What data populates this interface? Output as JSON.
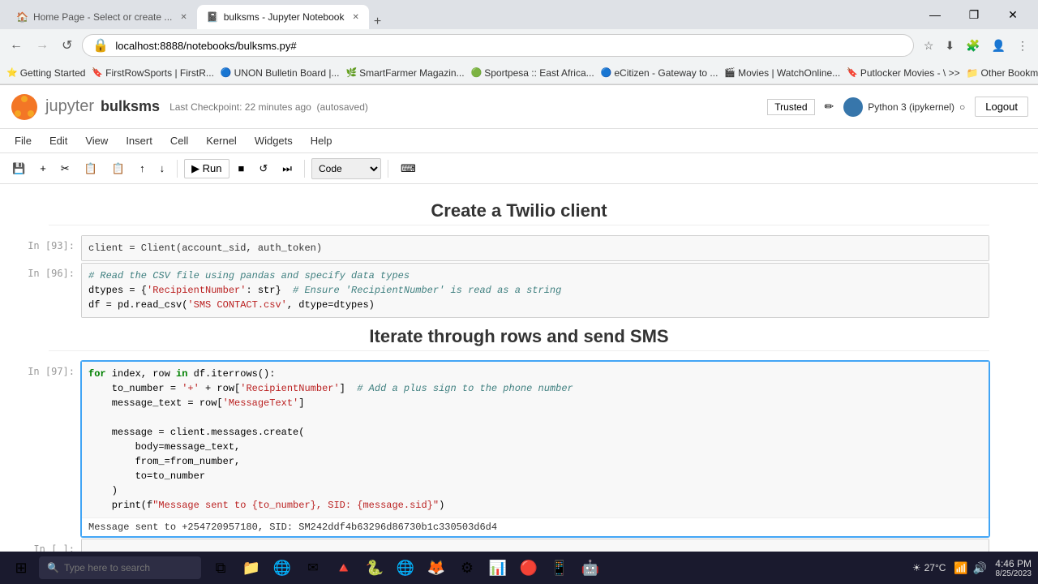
{
  "browser": {
    "tabs": [
      {
        "label": "Home Page - Select or create ...",
        "active": false,
        "favicon": "🏠"
      },
      {
        "label": "bulksms - Jupyter Notebook",
        "active": true,
        "favicon": "📓"
      }
    ],
    "address": "localhost:8888/notebooks/bulksms.py#",
    "window_controls": [
      "—",
      "❐",
      "✕"
    ]
  },
  "bookmarks": [
    {
      "label": "Getting Started",
      "icon": "⭐"
    },
    {
      "label": "FirstRowSports | FirstR...",
      "icon": "🔖"
    },
    {
      "label": "UNON Bulletin Board |...",
      "icon": "🔵"
    },
    {
      "label": "SmartFarmer Magazin...",
      "icon": "🌿"
    },
    {
      "label": "Sportpesa :: East Africa...",
      "icon": "🟢"
    },
    {
      "label": "eCitizen - Gateway to ...",
      "icon": "🔵"
    },
    {
      "label": "Movies | WatchOnline...",
      "icon": "🎬"
    },
    {
      "label": "Putlocker Movies - \\ >>",
      "icon": "🔖"
    },
    {
      "label": "Other Bookmarks",
      "icon": "📁"
    }
  ],
  "jupyter": {
    "logo_text": "jupyter",
    "notebook_name": "bulksms",
    "checkpoint": "Last Checkpoint: 22 minutes ago",
    "autosaved": "(autosaved)",
    "trusted": "Trusted",
    "kernel": "Python 3 (ipykernel)",
    "logout_label": "Logout",
    "menu": [
      "File",
      "Edit",
      "View",
      "Insert",
      "Cell",
      "Kernel",
      "Widgets",
      "Help"
    ],
    "cell_type": "Code"
  },
  "toolbar": {
    "buttons": [
      "💾",
      "+",
      "✂",
      "📋",
      "📋",
      "↑",
      "↓",
      "▶ Run",
      "■",
      "↺",
      "⏭"
    ]
  },
  "sections": {
    "twilio_heading": "Create a Twilio client",
    "iterate_heading": "Iterate through rows and send SMS"
  },
  "cells": {
    "cell93": {
      "label": "In [93]:",
      "code": "client = Client(account_sid, auth_token)"
    },
    "cell96": {
      "label": "In [96]:",
      "line1_comment": "# Read the CSV file using pandas and specify data types",
      "line2": "dtypes = {'RecipientNumber': str}  # Ensure 'RecipientNumber' is read as a string",
      "line3": "df = pd.read_csv('SMS CONTACT.csv', dtype=dtypes)"
    },
    "cell97": {
      "label": "In [97]:",
      "code_lines": [
        "for index, row in df.iterrows():",
        "    to_number = '+' + row['RecipientNumber']  # Add a plus sign to the phone number",
        "    message_text = row['MessageText']",
        "",
        "    message = client.messages.create(",
        "        body=message_text,",
        "        from_=from_number,",
        "        to=to_number",
        "    )",
        "    print(f\"Message sent to {to_number}, SID: {message.sid}\")"
      ],
      "output": "Message sent to +254720957180, SID: SM242ddf4b63296d86730b1c330503d6d4"
    },
    "empty_cell": {
      "label": "In [ ]:"
    }
  },
  "taskbar": {
    "search_placeholder": "Type here to search",
    "weather": "27°C",
    "time": "4:46 PM",
    "date": "8/25/2023"
  }
}
